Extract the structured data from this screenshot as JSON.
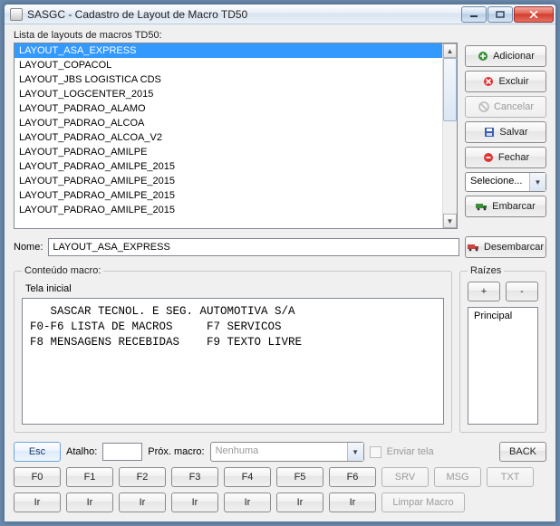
{
  "window": {
    "title": "SASGC - Cadastro de Layout de Macro TD50"
  },
  "list": {
    "label": "Lista de layouts de macros TD50:",
    "items": [
      "LAYOUT_ASA_EXPRESS",
      "LAYOUT_COPACOL",
      "LAYOUT_JBS LOGISTICA CDS",
      "LAYOUT_LOGCENTER_2015",
      "LAYOUT_PADRAO_ALAMO",
      "LAYOUT_PADRAO_ALCOA",
      "LAYOUT_PADRAO_ALCOA_V2",
      "LAYOUT_PADRAO_AMILPE",
      "LAYOUT_PADRAO_AMILPE_2015",
      "LAYOUT_PADRAO_AMILPE_2015",
      "LAYOUT_PADRAO_AMILPE_2015",
      "LAYOUT_PADRAO_AMILPE_2015"
    ],
    "selected_index": 0
  },
  "side": {
    "adicionar": "Adicionar",
    "excluir": "Excluir",
    "cancelar": "Cancelar",
    "salvar": "Salvar",
    "fechar": "Fechar",
    "selecione": "Selecione...",
    "embarcar": "Embarcar",
    "desembarcar": "Desembarcar"
  },
  "nome": {
    "label": "Nome:",
    "value": "LAYOUT_ASA_EXPRESS"
  },
  "content": {
    "legend": "Conteúdo macro:",
    "tela_label": "Tela inicial",
    "tela_text": "   SASCAR TECNOL. E SEG. AUTOMOTIVA S/A\nF0-F6 LISTA DE MACROS     F7 SERVICOS\nF8 MENSAGENS RECEBIDAS    F9 TEXTO LIVRE"
  },
  "raizes": {
    "legend": "Raízes",
    "plus": "+",
    "minus": "-",
    "items": [
      "Principal"
    ]
  },
  "bottom": {
    "esc": "Esc",
    "atalho_label": "Atalho:",
    "prox_label": "Próx. macro:",
    "prox_placeholder": "Nenhuma",
    "enviar_tela": "Enviar tela",
    "back": "BACK",
    "f": [
      "F0",
      "F1",
      "F2",
      "F3",
      "F4",
      "F5",
      "F6"
    ],
    "srv": "SRV",
    "msg": "MSG",
    "txt": "TXT",
    "ir": "Ir",
    "limpar": "Limpar Macro"
  }
}
